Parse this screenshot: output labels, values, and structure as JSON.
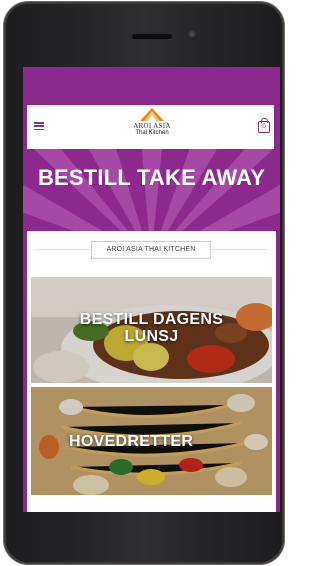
{
  "header": {
    "logo_name": "AROI ASIA",
    "logo_sub": "Thai Kitchen",
    "cart_count": "0"
  },
  "hero": {
    "title": "BESTILL TAKE AWAY"
  },
  "section": {
    "label": "AROI ASIA THAI KITCHEN"
  },
  "tiles": [
    {
      "label_line1": "BESTILL DAGENS",
      "label_line2": "LUNSJ"
    },
    {
      "label_line1": "HOVEDRETTER"
    }
  ],
  "colors": {
    "brand_purple": "#8b2a8c",
    "hero_ray_light": "#b35bb4",
    "logo_orange": "#e08a1e",
    "icons": [
      "menu-icon",
      "cart-icon",
      "logo-temple-icon"
    ]
  }
}
